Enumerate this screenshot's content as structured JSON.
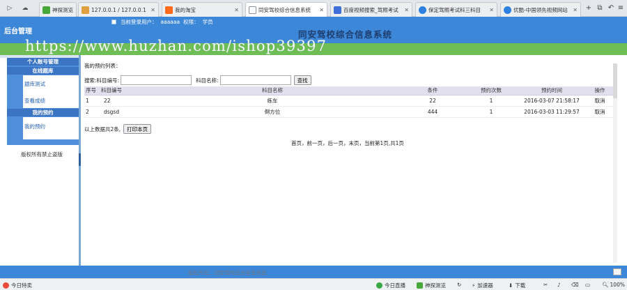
{
  "browser": {
    "tabs": [
      {
        "label": "神探测览",
        "icon": "green-app-icon",
        "active": false,
        "closable": false
      },
      {
        "label": "127.0.0.1 / 127.0.0.1",
        "icon": "phpmyadmin-icon",
        "active": false,
        "closable": true
      },
      {
        "label": "我的淘宝",
        "icon": "taobao-icon",
        "active": false,
        "closable": true
      },
      {
        "label": "同安驾校综合信息系统",
        "icon": "page-icon",
        "active": true,
        "closable": true
      },
      {
        "label": "百度视频搜索_驾照考试",
        "icon": "baidu-video-icon",
        "active": false,
        "closable": true
      },
      {
        "label": "保定驾照考试科三科目",
        "icon": "play-icon",
        "active": false,
        "closable": true
      },
      {
        "label": "优酷-中国领先视频网站",
        "icon": "play-icon",
        "active": false,
        "closable": true
      }
    ],
    "status": {
      "left": "今日特卖",
      "live": "今日直播",
      "browse": "神探测览",
      "accel": "加速器",
      "download": "下载",
      "zoom": "100%"
    }
  },
  "header": {
    "admin_title": "后台管理",
    "user_label": "当前登录用户：",
    "username": "aaaaaa",
    "role_label": "权限：",
    "role": "学员",
    "system_title": "同安驾校综合信息系统"
  },
  "watermark": "https://www.huzhan.com/ishop39397",
  "sidebar": {
    "sections": [
      {
        "title": "个人账号管理"
      },
      {
        "title": "在线题库",
        "links": [
          "题库测试",
          "查看成绩"
        ]
      },
      {
        "title": "我的预约",
        "links": [
          "我的预约"
        ]
      }
    ],
    "copyright": "版权所有禁止盗版"
  },
  "main": {
    "list_title": "我的预约列表：",
    "search": {
      "label_prefix": "搜索:",
      "code_label": "科目编号:",
      "name_label": "科目名称:",
      "code_value": "",
      "name_value": "",
      "button": "查找"
    },
    "table": {
      "headers": [
        "序号",
        "科目编号",
        "科目名称",
        "条件",
        "预约次数",
        "预约时间",
        "操作"
      ],
      "rows": [
        [
          "1",
          "22",
          "练车",
          "22",
          "1",
          "2016-03-07 21:58:17",
          "取消"
        ],
        [
          "2",
          "dsgsd",
          "倒方位",
          "444",
          "1",
          "2016-03-03 11:29:57",
          "取消"
        ]
      ]
    },
    "summary": "以上数据共2条,",
    "print_button": "打印本页",
    "pager": "首页，前一页，后一页，末页，当前第1页,共1页"
  },
  "footer": {
    "text": "版权所有：同安驾校综合信息系统"
  },
  "colors": {
    "header_blue": "#3d87d9",
    "menu_blue": "#4f8fd9",
    "menu_head_blue": "#3c74c4",
    "green_bar": "#6fbe55",
    "table_header": "#e2e0ef"
  }
}
